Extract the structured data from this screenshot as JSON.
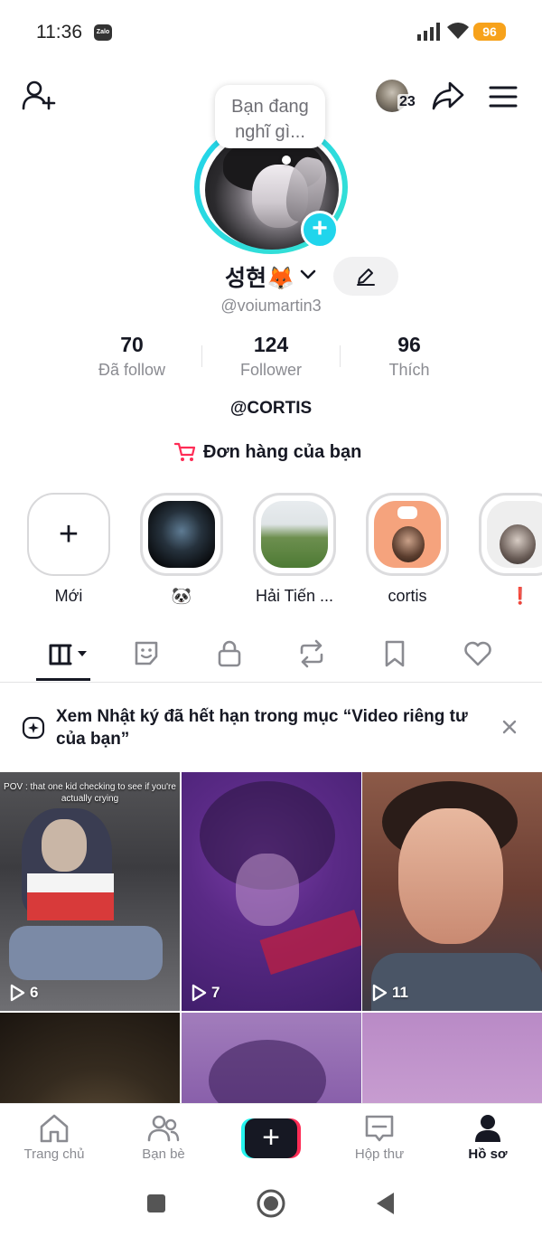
{
  "status_bar": {
    "time": "11:36",
    "notification_app": "Zalo",
    "battery": "96"
  },
  "header": {
    "friend_count": "23",
    "thought_bubble": [
      "Bạn đang",
      "nghĩ gì..."
    ]
  },
  "profile": {
    "display_name": "성현🦊",
    "username": "@voiumartin3",
    "bio": "@CORTIS",
    "orders_label": "Đơn hàng của bạn"
  },
  "stats": [
    {
      "value": "70",
      "label": "Đã follow"
    },
    {
      "value": "124",
      "label": "Follower"
    },
    {
      "value": "96",
      "label": "Thích"
    }
  ],
  "stories": [
    {
      "label": "Mới"
    },
    {
      "label": "🐼"
    },
    {
      "label": "Hải Tiến ..."
    },
    {
      "label": "cortis"
    },
    {
      "label": "❗"
    }
  ],
  "banner": {
    "text": "Xem Nhật ký đã hết hạn trong mục “Video riêng tư của bạn”"
  },
  "videos": [
    {
      "views": "6",
      "caption": "POV : that one kid checking to see if you're actually crying"
    },
    {
      "views": "7"
    },
    {
      "views": "11"
    }
  ],
  "bottom_nav": [
    {
      "label": "Trang chủ"
    },
    {
      "label": "Bạn bè"
    },
    {
      "label": ""
    },
    {
      "label": "Hộp thư"
    },
    {
      "label": "Hồ sơ"
    }
  ],
  "colors": {
    "accent": "#fe2c55",
    "cyan": "#25f4ee",
    "ring": "#20d5ec",
    "battery": "#f7a21b"
  }
}
